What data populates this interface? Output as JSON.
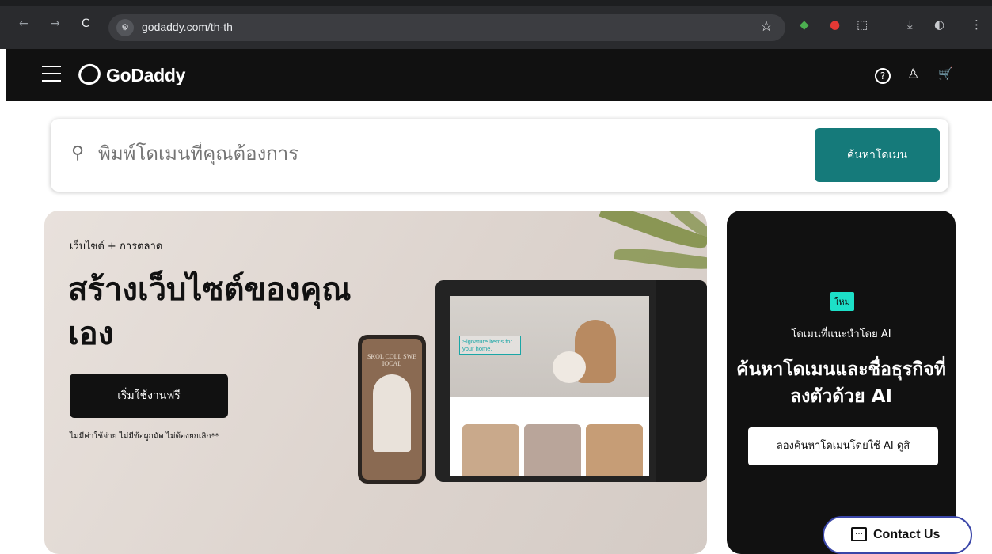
{
  "browser": {
    "url": "godaddy.com/th-th",
    "back_icon": "←",
    "forward_icon": "→",
    "reload_icon": "C",
    "tune_icon": "⚙",
    "star_icon": "☆",
    "download_icon": "⤓",
    "menu_icon": "⋮"
  },
  "header": {
    "logo_text": "GoDaddy",
    "help_icon": "?",
    "account_icon": "♙",
    "cart_icon": "🛒"
  },
  "search": {
    "placeholder": "พิมพ์โดเมนที่คุณต้องการ",
    "button_label": "ค้นหาโดเมน",
    "search_icon": "🔍"
  },
  "hero": {
    "eyebrow": "เว็บไซต์ + การตลาด",
    "headline": "สร้างเว็บไซต์ของคุณเอง",
    "cta_label": "เริ่มใช้งานฟรี",
    "fine_print": "ไม่มีค่าใช้จ่าย ไม่มีข้อผูกมัด ไม่ต้องยกเลิก**",
    "phone_title": "SKOL COLL SWE IOCAL",
    "tablet_caption": "Signature items for your home."
  },
  "ai_card": {
    "badge": "ใหม่",
    "subtitle": "โดเมนที่แนะนำโดย AI",
    "headline": "ค้นหาโดเมนและชื่อธุรกิจที่ลงตัวด้วย AI",
    "button_label": "ลองค้นหาโดเมนโดยใช้ AI ดูสิ"
  },
  "contact": {
    "label": "Contact Us",
    "icon": "…"
  },
  "colors": {
    "primary_teal": "#157a7a",
    "badge_mint": "#1de0c8",
    "dark": "#111111"
  }
}
